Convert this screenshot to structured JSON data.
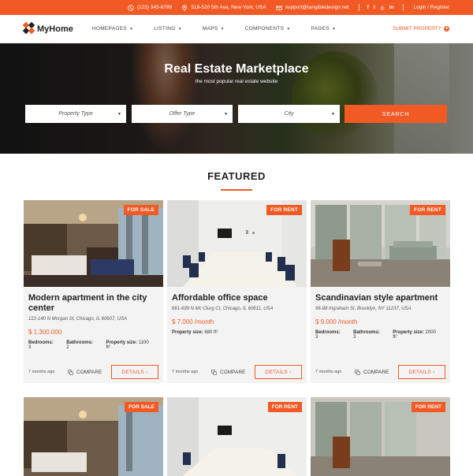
{
  "topbar": {
    "phone": "(123) 345-6789",
    "address": "518-520 5th Ave, New York, USA",
    "email": "support@tangibledesign.net",
    "social": [
      "f",
      "t",
      "◎",
      "in"
    ],
    "auth": "Login / Register"
  },
  "header": {
    "logo_text": "MyHome",
    "nav": [
      "HOMEPAGES",
      "LISTING",
      "MAPS",
      "COMPONENTS",
      "PAGES"
    ],
    "submit": "SUBMIT PROPERTY"
  },
  "hero": {
    "title": "Real Estate Marketplace",
    "subtitle": "the most popular real estate website",
    "search": {
      "property_type": "Property Type",
      "offer_type": "Offer Type",
      "city": "City",
      "button": "SEARCH"
    }
  },
  "featured": {
    "heading": "FEATURED",
    "cards": [
      {
        "badge": "FOR SALE",
        "title": "Modern apartment in the city center",
        "address": "122-140 N Morgan St, Chicago, IL 60607, USA",
        "price": "$ 1.300.000",
        "bedrooms_label": "Bedrooms:",
        "bedrooms": "3",
        "bathrooms_label": "Bathrooms:",
        "bathrooms": "2",
        "size_label": "Property size:",
        "size": "1100 ft²",
        "ago": "7 months ago",
        "compare": "COMPARE",
        "details": "DETAILS ›"
      },
      {
        "badge": "FOR RENT",
        "title": "Affordable office space",
        "address": "661-699 N Mc Clurg Ct, Chicago, IL 60611, USA",
        "price": "$ 7.000 /month",
        "size_label": "Property size:",
        "size": "680 ft²",
        "ago": "7 months ago",
        "compare": "COMPARE",
        "details": "DETAILS ›"
      },
      {
        "badge": "FOR RENT",
        "title": "Scandinavian style apartment",
        "address": "96-98 Ingraham St, Brooklyn, NY 11237, USA",
        "price": "$ 9.000 /month",
        "bedrooms_label": "Bedrooms:",
        "bedrooms": "3",
        "bathrooms_label": "Bathrooms:",
        "bathrooms": "3",
        "size_label": "Property size:",
        "size": "2000 ft²",
        "ago": "7 months ago",
        "compare": "COMPARE",
        "details": "DETAILS ›"
      }
    ],
    "second_row_badges": [
      "FOR SALE",
      "FOR RENT",
      "FOR RENT"
    ]
  },
  "colors": {
    "accent": "#f15a24"
  }
}
